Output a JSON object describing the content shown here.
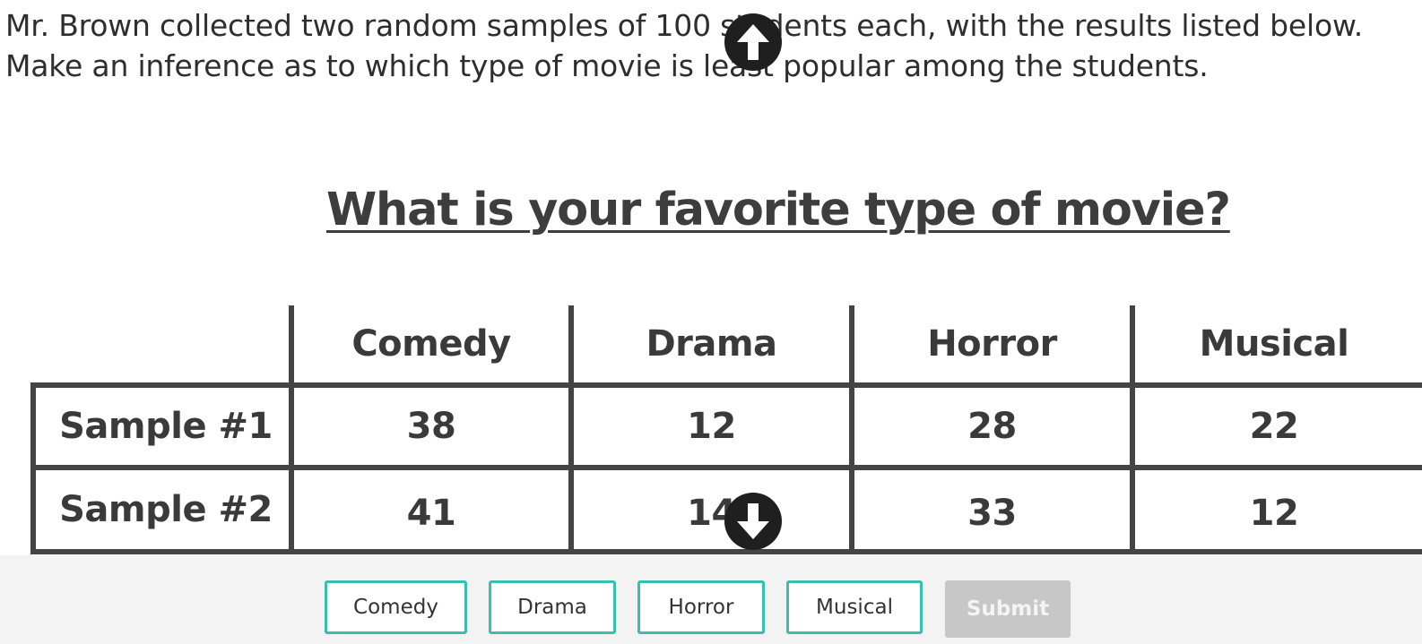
{
  "question": {
    "line1": "Mr. Brown collected two random samples of 100 students each, with the results listed below.",
    "line2": "Make an inference as to which type of movie is least popular among the students."
  },
  "table": {
    "title": "What is your favorite type of movie?",
    "columns": [
      "Comedy",
      "Drama",
      "Horror",
      "Musical"
    ],
    "rows": [
      {
        "label": "Sample #1",
        "values": [
          "38",
          "12",
          "28",
          "22"
        ]
      },
      {
        "label": "Sample #2",
        "values": [
          "41",
          "14",
          "33",
          "12"
        ]
      }
    ]
  },
  "answer_choices": [
    "Comedy",
    "Drama",
    "Horror",
    "Musical"
  ],
  "submit_label": "Submit",
  "icons": {
    "scroll_up": "arrow-up-circle-icon",
    "scroll_down": "arrow-down-circle-icon"
  },
  "colors": {
    "choice_border": "#37bfb0",
    "submit_disabled": "#c7c7c7",
    "footer_bg": "#f3f3f3",
    "table_line": "#444444"
  }
}
